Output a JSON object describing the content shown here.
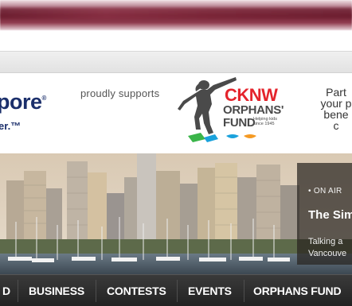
{
  "banner": {
    "brand_text": "pore",
    "brand_tm": "®",
    "brand_tagline": "er.™",
    "proudly_supports": "proudly supports",
    "fund": {
      "line1": "CKNW",
      "line2": "ORPHANS'",
      "line3": "FUND",
      "tagline": "Helping kids since 1945"
    },
    "partner_lines": [
      "Part",
      "your p",
      "bene",
      "c"
    ]
  },
  "on_air": {
    "label": "• ON AIR",
    "title": "The Sim",
    "desc_lines": [
      "Talking a",
      "Vancouve"
    ]
  },
  "nav": {
    "items": [
      "D",
      "BUSINESS",
      "CONTESTS",
      "EVENTS",
      "ORPHANS FUND"
    ]
  },
  "colors": {
    "brand_blue": "#1b2f6b",
    "cknw_red": "#e4242c",
    "nav_bg": "#2a2a2a",
    "top_bar": "#7a2a3c"
  }
}
